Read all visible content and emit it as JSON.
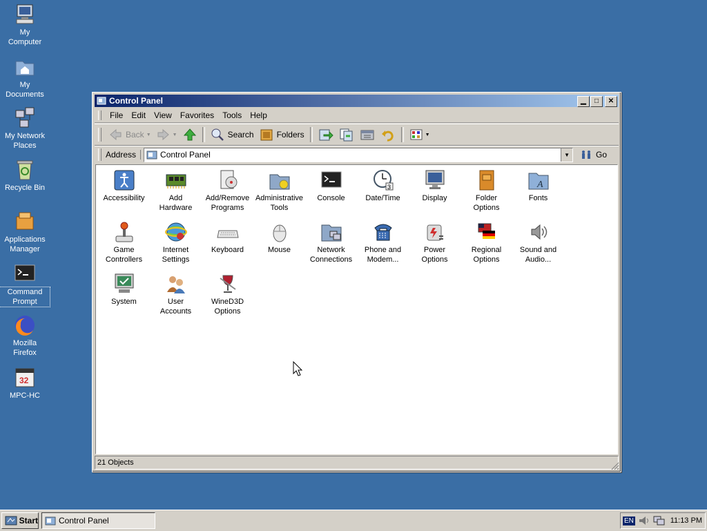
{
  "desktop": {
    "icons": [
      {
        "label_1": "My",
        "label_2": "Computer"
      },
      {
        "label_1": "My",
        "label_2": "Documents"
      },
      {
        "label_1": "My Network",
        "label_2": "Places"
      },
      {
        "label_1": "Recycle Bin",
        "label_2": ""
      },
      {
        "label_1": "Applications",
        "label_2": "Manager"
      },
      {
        "label_1": "Command",
        "label_2": "Prompt"
      },
      {
        "label_1": "Mozilla",
        "label_2": "Firefox"
      },
      {
        "label_1": "MPC-HC",
        "label_2": ""
      }
    ]
  },
  "window": {
    "title": "Control Panel",
    "menu": [
      "File",
      "Edit",
      "View",
      "Favorites",
      "Tools",
      "Help"
    ],
    "toolbar": {
      "back": "Back",
      "search": "Search",
      "folders": "Folders"
    },
    "address": {
      "label": "Address",
      "value": "Control Panel",
      "go": "Go"
    },
    "items": [
      {
        "l1": "Accessibility",
        "l2": ""
      },
      {
        "l1": "Add",
        "l2": "Hardware"
      },
      {
        "l1": "Add/Remove",
        "l2": "Programs"
      },
      {
        "l1": "Administrative",
        "l2": "Tools"
      },
      {
        "l1": "Console",
        "l2": ""
      },
      {
        "l1": "Date/Time",
        "l2": ""
      },
      {
        "l1": "Display",
        "l2": ""
      },
      {
        "l1": "Folder",
        "l2": "Options"
      },
      {
        "l1": "Fonts",
        "l2": ""
      },
      {
        "l1": "Game",
        "l2": "Controllers"
      },
      {
        "l1": "Internet",
        "l2": "Settings"
      },
      {
        "l1": "Keyboard",
        "l2": ""
      },
      {
        "l1": "Mouse",
        "l2": ""
      },
      {
        "l1": "Network",
        "l2": "Connections"
      },
      {
        "l1": "Phone and",
        "l2": "Modem..."
      },
      {
        "l1": "Power",
        "l2": "Options"
      },
      {
        "l1": "Regional",
        "l2": "Options"
      },
      {
        "l1": "Sound and",
        "l2": "Audio..."
      },
      {
        "l1": "System",
        "l2": ""
      },
      {
        "l1": "User",
        "l2": "Accounts"
      },
      {
        "l1": "WineD3D",
        "l2": "Options"
      }
    ],
    "status": "21 Objects"
  },
  "taskbar": {
    "start": "Start",
    "task": "Control Panel",
    "lang": "EN",
    "clock": "11:13 PM"
  },
  "colors": {
    "desktop": "#3a6ea5",
    "title_start": "#0a246a",
    "title_end": "#a6caf0"
  }
}
